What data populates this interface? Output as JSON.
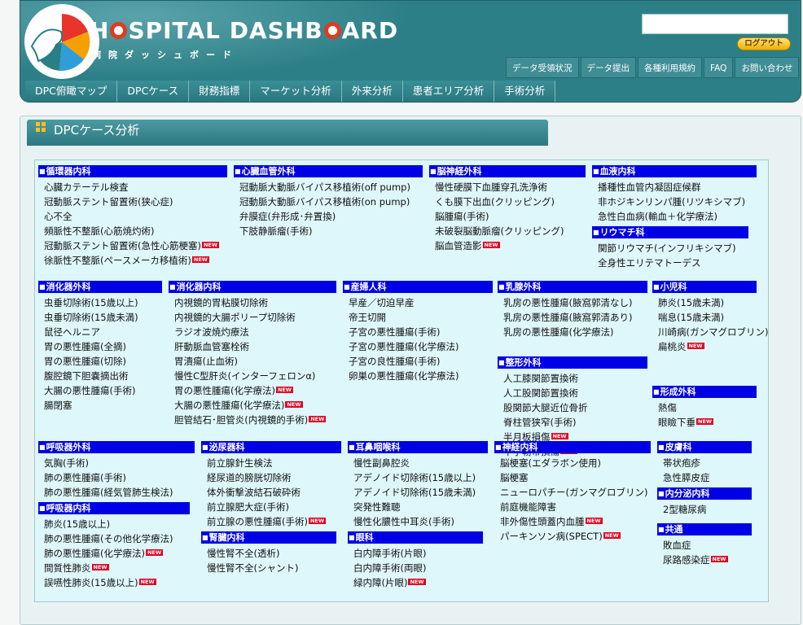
{
  "header": {
    "title_pre": "H",
    "title_mid": "SPITAL DASHB",
    "title_end": "ARD",
    "subtitle": "病院ダッシュボード",
    "logout": "ログアウト",
    "util_nav": [
      "データ受領状況",
      "データ提出",
      "各種利用規約",
      "FAQ",
      "お問い合わせ"
    ],
    "main_nav": [
      "DPC俯瞰マップ",
      "DPCケース",
      "財務指標",
      "マーケット分析",
      "外来分析",
      "患者エリア分析",
      "手術分析"
    ]
  },
  "section": {
    "title": "DPCケース分析"
  },
  "new_badge": "NEW",
  "categories": [
    {
      "name": "循環器内科",
      "items": [
        {
          "t": "心臓カテーテル検査"
        },
        {
          "t": "冠動脈ステント留置術(狭心症)"
        },
        {
          "t": "心不全"
        },
        {
          "t": "頻脈性不整脈(心筋焼灼術)"
        },
        {
          "t": "冠動脈ステント留置術(急性心筋梗塞)",
          "n": true
        },
        {
          "t": "徐脈性不整脈(ペースメーカ移植術)",
          "n": true
        }
      ]
    },
    {
      "name": "心臓血管外科",
      "items": [
        {
          "t": "冠動脈大動脈バイパス移植術(off pump)"
        },
        {
          "t": "冠動脈大動脈バイパス移植術(on pump)"
        },
        {
          "t": "弁膜症(弁形成･弁置換)"
        },
        {
          "t": "下肢静脈瘤(手術)"
        }
      ]
    },
    {
      "name": "脳神経外科",
      "items": [
        {
          "t": "慢性硬膜下血腫穿孔洗浄術"
        },
        {
          "t": "くも膜下出血(クリッピング)"
        },
        {
          "t": "脳腫瘍(手術)"
        },
        {
          "t": "未破裂脳動脈瘤(クリッピング)"
        },
        {
          "t": "脳血管造影",
          "n": true
        }
      ]
    },
    {
      "name": "血液内科",
      "items": [
        {
          "t": "播種性血管内凝固症候群"
        },
        {
          "t": "非ホジキンリンパ腫(リツキシマブ)"
        },
        {
          "t": "急性白血病(輸血＋化学療法)"
        }
      ]
    },
    {
      "name": "リウマチ科",
      "items": [
        {
          "t": "関節リウマチ(インフリキシマブ)"
        },
        {
          "t": "全身性エリテマトーデス"
        }
      ]
    },
    {
      "name": "消化器外科",
      "items": [
        {
          "t": "虫垂切除術(15歳以上)"
        },
        {
          "t": "虫垂切除術(15歳未満)"
        },
        {
          "t": "鼠径ヘルニア"
        },
        {
          "t": "胃の悪性腫瘍(全摘)"
        },
        {
          "t": "胃の悪性腫瘍(切除)"
        },
        {
          "t": "腹腔鏡下胆嚢摘出術"
        },
        {
          "t": "大腸の悪性腫瘍(手術)"
        },
        {
          "t": "腸閉塞"
        }
      ]
    },
    {
      "name": "消化器内科",
      "items": [
        {
          "t": "内視鏡的胃粘膜切除術"
        },
        {
          "t": "内視鏡的大腸ポリープ切除術"
        },
        {
          "t": "ラジオ波焼灼療法"
        },
        {
          "t": "肝動脈血管塞栓術"
        },
        {
          "t": "胃潰瘍(止血術)"
        },
        {
          "t": "慢性C型肝炎(インターフェロンα)"
        },
        {
          "t": "胃の悪性腫瘍(化学療法)",
          "n": true
        },
        {
          "t": "大腸の悪性腫瘍(化学療法)",
          "n": true
        },
        {
          "t": "胆管結石･胆管炎(内視鏡的手術)",
          "n": true
        }
      ]
    },
    {
      "name": "産婦人科",
      "items": [
        {
          "t": "早産／切迫早産"
        },
        {
          "t": "帝王切開"
        },
        {
          "t": "子宮の悪性腫瘍(手術)"
        },
        {
          "t": "子宮の悪性腫瘍(化学療法)"
        },
        {
          "t": "子宮の良性腫瘍(手術)"
        },
        {
          "t": "卵巣の悪性腫瘍(化学療法)"
        }
      ]
    },
    {
      "name": "乳腺外科",
      "items": [
        {
          "t": "乳房の悪性腫瘍(腋窩郭清なし)"
        },
        {
          "t": "乳房の悪性腫瘍(腋窩郭清あり)"
        },
        {
          "t": "乳房の悪性腫瘍(化学療法)"
        }
      ]
    },
    {
      "name": "小児科",
      "items": [
        {
          "t": "肺炎(15歳未満)"
        },
        {
          "t": "喘息(15歳未満)"
        },
        {
          "t": "川崎病(ガンマグロブリン)"
        },
        {
          "t": "扁桃炎",
          "n": true
        }
      ]
    },
    {
      "name": "整形外科",
      "items": [
        {
          "t": "人工膝関節置換術"
        },
        {
          "t": "人工股関節置換術"
        },
        {
          "t": "股関節大腿近位骨折"
        },
        {
          "t": "脊柱管狭窄(手術)"
        },
        {
          "t": "半月板損傷",
          "n": true
        },
        {
          "t": "十字靭帯損傷",
          "n": true
        }
      ]
    },
    {
      "name": "形成外科",
      "items": [
        {
          "t": "熱傷"
        },
        {
          "t": "眼瞼下垂",
          "n": true
        }
      ]
    },
    {
      "name": "呼吸器外科",
      "items": [
        {
          "t": "気胸(手術)"
        },
        {
          "t": "肺の悪性腫瘍(手術)"
        },
        {
          "t": "肺の悪性腫瘍(経気管肺生検法)"
        }
      ]
    },
    {
      "name": "呼吸器内科",
      "items": [
        {
          "t": "肺炎(15歳以上)"
        },
        {
          "t": "肺の悪性腫瘍(その他化学療法)"
        },
        {
          "t": "肺の悪性腫瘍(化学療法)",
          "n": true
        },
        {
          "t": "間質性肺炎",
          "n": true
        },
        {
          "t": "誤嚥性肺炎(15歳以上)",
          "n": true
        }
      ]
    },
    {
      "name": "泌尿器科",
      "items": [
        {
          "t": "前立腺針生検法"
        },
        {
          "t": "経尿道的膀胱切除術"
        },
        {
          "t": "体外衝撃波結石破砕術"
        },
        {
          "t": "前立腺肥大症(手術)"
        },
        {
          "t": "前立腺の悪性腫瘍(手術)",
          "n": true
        }
      ]
    },
    {
      "name": "腎臓内科",
      "items": [
        {
          "t": "慢性腎不全(透析)"
        },
        {
          "t": "慢性腎不全(シャント)"
        }
      ]
    },
    {
      "name": "耳鼻咽喉科",
      "items": [
        {
          "t": "慢性副鼻腔炎"
        },
        {
          "t": "アデノイド切除術(15歳以上)"
        },
        {
          "t": "アデノイド切除術(15歳未満)"
        },
        {
          "t": "突発性難聴"
        },
        {
          "t": "慢性化膿性中耳炎(手術)"
        }
      ]
    },
    {
      "name": "眼科",
      "items": [
        {
          "t": "白内障手術(片眼)"
        },
        {
          "t": "白内障手術(両眼)"
        },
        {
          "t": "緑内障(片眼)",
          "n": true
        }
      ]
    },
    {
      "name": "神経内科",
      "items": [
        {
          "t": "脳梗塞(エダラボン使用)"
        },
        {
          "t": "脳梗塞"
        },
        {
          "t": "ニューロパチー(ガンマグロブリン)"
        },
        {
          "t": "前庭機能障害"
        },
        {
          "t": "非外傷性頭蓋内血腫",
          "n": true
        },
        {
          "t": "パーキンソン病(SPECT)",
          "n": true
        }
      ]
    },
    {
      "name": "皮膚科",
      "items": [
        {
          "t": "帯状疱疹"
        },
        {
          "t": "急性膵皮症"
        }
      ]
    },
    {
      "name": "内分泌内科",
      "items": [
        {
          "t": "2型糖尿病"
        }
      ]
    },
    {
      "name": "共通",
      "items": [
        {
          "t": "敗血症"
        },
        {
          "t": "尿路感染症",
          "n": true
        }
      ]
    }
  ]
}
